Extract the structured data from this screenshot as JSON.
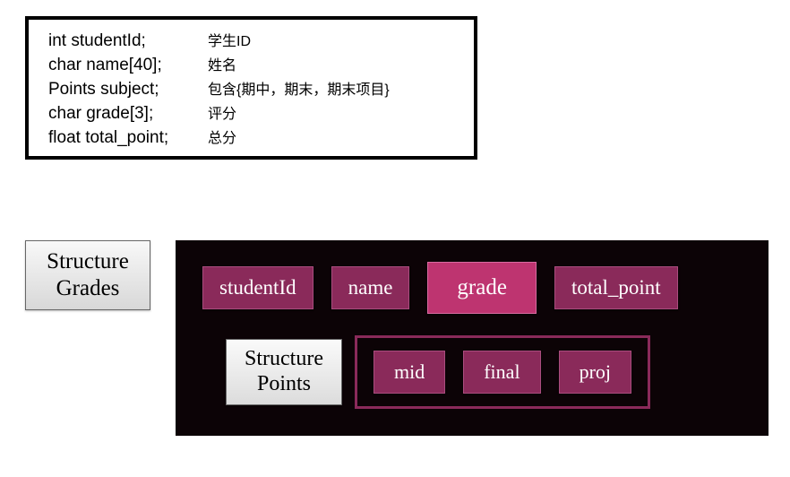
{
  "code_rows": [
    {
      "decl": "int studentId;",
      "note": "学生ID"
    },
    {
      "decl": "char name[40];",
      "note": "姓名"
    },
    {
      "decl": "Points subject;",
      "note": "包含{期中，期末，期末项目}"
    },
    {
      "decl": "char grade[3];",
      "note": "评分"
    },
    {
      "decl": "float total_point;",
      "note": "总分"
    }
  ],
  "struct_grades_label_l1": "Structure",
  "struct_grades_label_l2": "Grades",
  "struct_points_label_l1": "Structure",
  "struct_points_label_l2": "Points",
  "fields_top": {
    "studentId": "studentId",
    "name": "name",
    "grade": "grade",
    "total_point": "total_point"
  },
  "fields_points": {
    "mid": "mid",
    "final": "final",
    "proj": "proj"
  }
}
